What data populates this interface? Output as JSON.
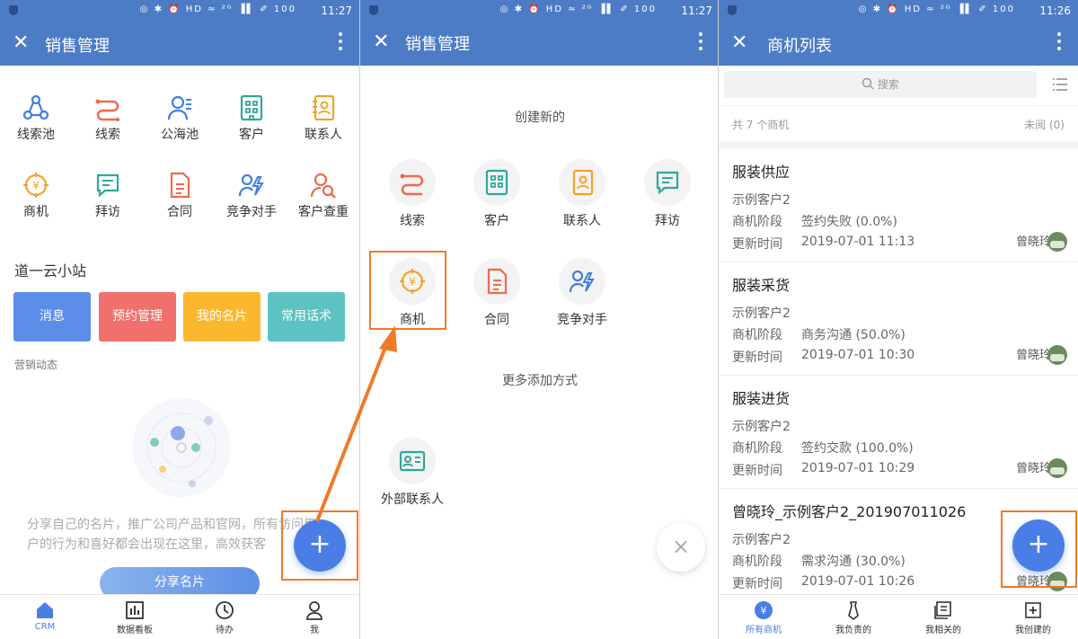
{
  "status": {
    "icons": "◎ ✱ ⏰ HD ≈ ²ᴳ ▐▌ ✐ 100",
    "time1": "11:27",
    "time2": "11:27",
    "time3": "11:26"
  },
  "screen1": {
    "title": "销售管理",
    "grid": [
      "线索池",
      "线索",
      "公海池",
      "客户",
      "联系人",
      "商机",
      "拜访",
      "合同",
      "竞争对手",
      "客户查重"
    ],
    "section": "道一云小站",
    "cards": [
      {
        "label": "消息",
        "color": "#5b8de9"
      },
      {
        "label": "预约管理",
        "color": "#f2706c"
      },
      {
        "label": "我的名片",
        "color": "#fbb82f"
      },
      {
        "label": "常用话术",
        "color": "#5dc2c2"
      }
    ],
    "marketing": "营销动态",
    "empty_text": "分享自己的名片，推广公司产品和官网，所有访问用户的行为和喜好都会出现在这里，高效获客",
    "share_button": "分享名片",
    "fab": "+",
    "tabs": [
      "CRM",
      "数据看板",
      "待办",
      "我"
    ]
  },
  "screen2": {
    "title": "销售管理",
    "create_heading": "创建新的",
    "create_items": [
      "线索",
      "客户",
      "联系人",
      "拜访",
      "商机",
      "合同",
      "竞争对手"
    ],
    "more_heading": "更多添加方式",
    "more_items": [
      "外部联系人"
    ],
    "close_fab": "×"
  },
  "screen3": {
    "title": "商机列表",
    "search_placeholder": "搜索",
    "count": "共 7 个商机",
    "unread": "未阅 (0)",
    "stage_label": "商机阶段",
    "time_label": "更新时间",
    "items": [
      {
        "name": "服装供应",
        "customer": "示例客户2",
        "stage": "签约失败 (0.0%)",
        "time": "2019-07-01 11:13",
        "owner": "曾晓玲"
      },
      {
        "name": "服装采货",
        "customer": "示例客户2",
        "stage": "商务沟通 (50.0%)",
        "time": "2019-07-01 10:30",
        "owner": "曾晓玲"
      },
      {
        "name": "服装进货",
        "customer": "示例客户2",
        "stage": "签约交款 (100.0%)",
        "time": "2019-07-01 10:29",
        "owner": "曾晓玲"
      },
      {
        "name": "曾晓玲_示例客户2_201907011026",
        "customer": "示例客户2",
        "stage": "需求沟通 (30.0%)",
        "time": "2019-07-01 10:26",
        "owner": "曾晓玲"
      }
    ],
    "fab": "+",
    "tabs": [
      "所有商机",
      "我负责的",
      "我相关的",
      "我创建的"
    ]
  }
}
